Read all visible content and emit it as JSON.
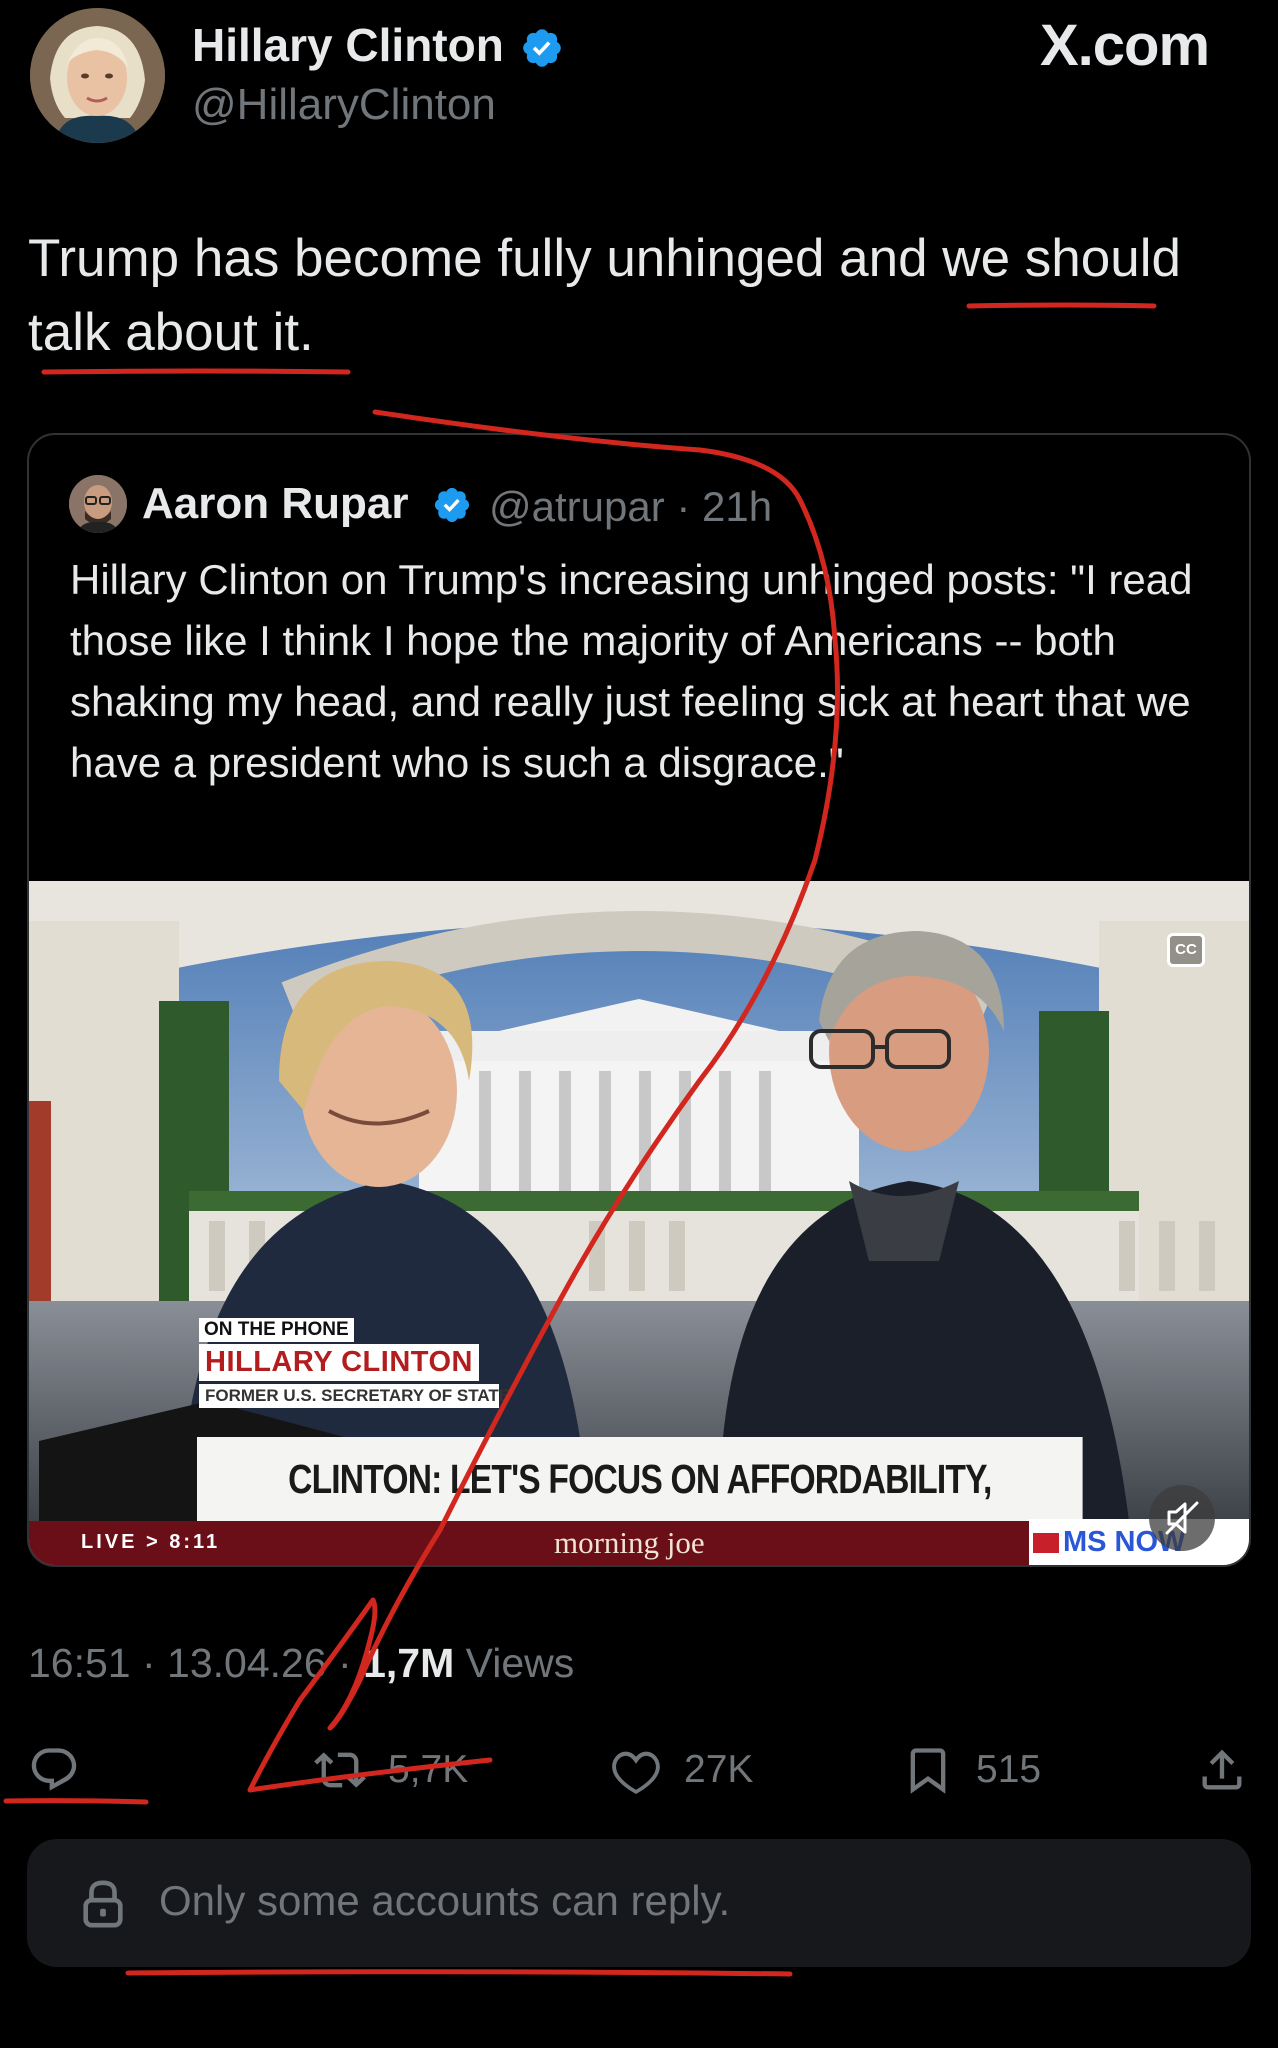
{
  "header": {
    "author_name": "Hillary Clinton",
    "author_handle": "@HillaryClinton",
    "watermark": "X.com"
  },
  "tweet": {
    "text_line1": "Trump has become fully unhinged and we should",
    "text_line2": "talk about it."
  },
  "quote": {
    "author_name": "Aaron Rupar",
    "handle_time": "@atrupar · 21h",
    "text": "Hillary Clinton on Trump's increasing unhinged posts: \"I read those like I think I hope the majority of Americans -- both shaking my head, and really just feeling sick at heart that we have a president who is such a disgrace.\"",
    "video": {
      "cc_label": "CC",
      "kicker": "ON THE PHONE",
      "guest_name": "HILLARY CLINTON",
      "guest_role": "FORMER U.S. SECRETARY OF STATE",
      "headline": "CLINTON: LET'S FOCUS ON AFFORDABILITY, ACCOUNTABILITY",
      "live_label": "LIVE > 8:11",
      "show_logo": "morning joe",
      "network_logo": "MS NOW"
    }
  },
  "meta": {
    "time_date": "16:51 · 13.04.26 · ",
    "views_count": "1,7M",
    "views_label": " Views"
  },
  "actions": {
    "reply_count": "",
    "retweet_count": "5,7K",
    "like_count": "27K",
    "bookmark_count": "515"
  },
  "reply_restriction": {
    "text": "Only some accounts can reply."
  },
  "colors": {
    "background": "#000000",
    "text": "#e7e9ea",
    "muted": "#71767b",
    "verified": "#1d9bf0",
    "annotation": "#d2271f"
  }
}
